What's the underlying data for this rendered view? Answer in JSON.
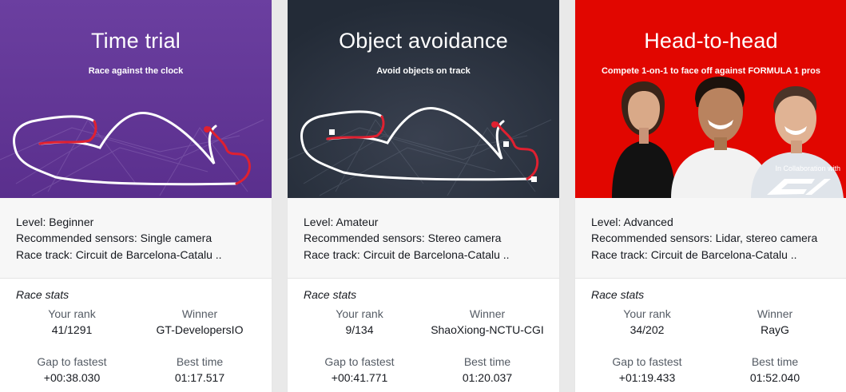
{
  "cards": [
    {
      "title": "Time trial",
      "subtitle": "Race against the clock",
      "color": "#6b3fa0",
      "level": "Level: Beginner",
      "sensors": "Recommended sensors: Single camera",
      "track": "Race track: Circuit de Barcelona-Catalu ..",
      "stats_title": "Race stats",
      "rank_label": "Your rank",
      "rank_value": "41/1291",
      "winner_label": "Winner",
      "winner_value": "GT-DevelopersIO",
      "gap_label": "Gap to fastest",
      "gap_value": "+00:38.030",
      "best_label": "Best time",
      "best_value": "01:17.517"
    },
    {
      "title": "Object avoidance",
      "subtitle": "Avoid objects on track",
      "color": "#232b37",
      "level": "Level: Amateur",
      "sensors": "Recommended sensors: Stereo camera",
      "track": "Race track: Circuit de Barcelona-Catalu ..",
      "stats_title": "Race stats",
      "rank_label": "Your rank",
      "rank_value": "9/134",
      "winner_label": "Winner",
      "winner_value": "ShaoXiong-NCTU-CGI",
      "gap_label": "Gap to fastest",
      "gap_value": "+00:41.771",
      "best_label": "Best time",
      "best_value": "01:20.037"
    },
    {
      "title": "Head-to-head",
      "subtitle": "Compete 1-on-1 to face off against FORMULA 1 pros",
      "color": "#e10600",
      "collab": "In Collaboration with",
      "logo_text": "F1",
      "level": "Level: Advanced",
      "sensors": "Recommended sensors: Lidar, stereo camera",
      "track": "Race track: Circuit de Barcelona-Catalu ..",
      "stats_title": "Race stats",
      "rank_label": "Your rank",
      "rank_value": "34/202",
      "winner_label": "Winner",
      "winner_value": "RayG",
      "gap_label": "Gap to fastest",
      "gap_value": "+01:19.433",
      "best_label": "Best time",
      "best_value": "01:52.040"
    }
  ]
}
